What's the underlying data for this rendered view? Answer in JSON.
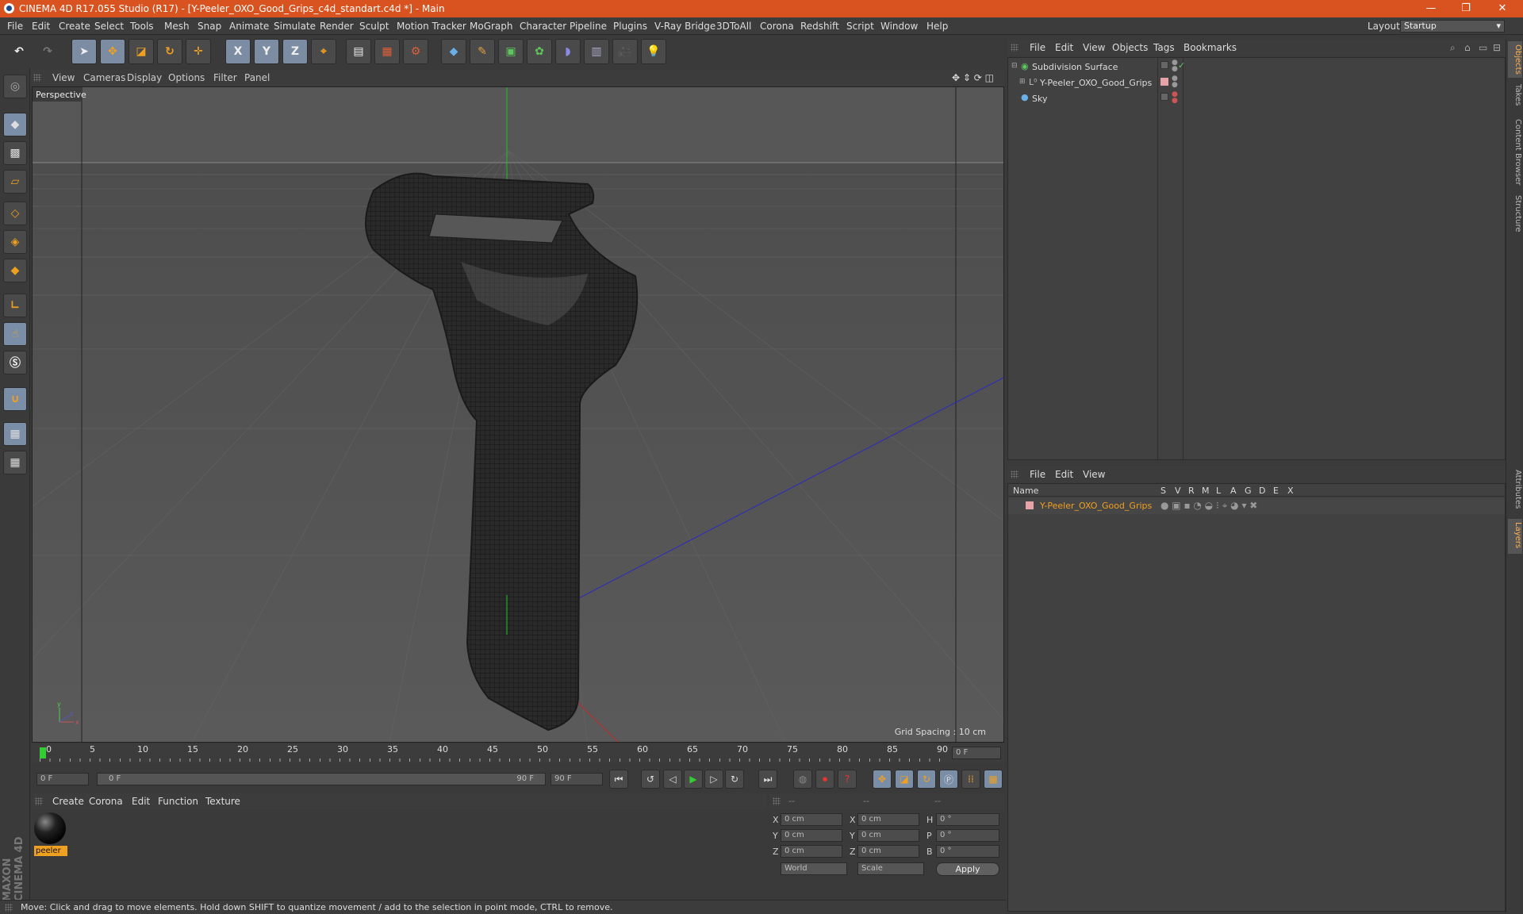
{
  "window": {
    "title": "CINEMA 4D R17.055 Studio (R17) - [Y-Peeler_OXO_Good_Grips_c4d_standart.c4d *] - Main",
    "minimize": "—",
    "maximize": "❐",
    "close": "✕"
  },
  "menu": [
    "File",
    "Edit",
    "Create",
    "Select",
    "Tools",
    "Mesh",
    "Snap",
    "Animate",
    "Simulate",
    "Render",
    "Sculpt",
    "Motion Tracker",
    "MoGraph",
    "Character",
    "Pipeline",
    "Plugins",
    "V-Ray Bridge",
    "3DToAll",
    "Corona",
    "Redshift",
    "Script",
    "Window",
    "Help"
  ],
  "layout": {
    "label": "Layout:",
    "value": "Startup"
  },
  "toolbar": {
    "axis_x": "X",
    "axis_y": "Y",
    "axis_z": "Z"
  },
  "viewport": {
    "menu": [
      "View",
      "Cameras",
      "Display",
      "Options",
      "Filter",
      "Panel"
    ],
    "label": "Perspective",
    "grid_spacing": "Grid Spacing : 10 cm"
  },
  "timeline": {
    "ticks": [
      "0",
      "5",
      "10",
      "15",
      "20",
      "25",
      "30",
      "35",
      "40",
      "45",
      "50",
      "55",
      "60",
      "65",
      "70",
      "75",
      "80",
      "85",
      "90"
    ],
    "end_field": "0 F",
    "current_field": "0 F",
    "range_start": "0 F",
    "range_end": "90 F",
    "max_field": "90 F"
  },
  "materials": {
    "menu": [
      "Create",
      "Corona",
      "Edit",
      "Function",
      "Texture"
    ],
    "items": [
      {
        "name": "peeler"
      }
    ]
  },
  "coordinates": {
    "headers": [
      "--",
      "--",
      "--"
    ],
    "rows": [
      {
        "a": "X",
        "av": "0 cm",
        "b": "X",
        "bv": "0 cm",
        "c": "H",
        "cv": "0 °"
      },
      {
        "a": "Y",
        "av": "0 cm",
        "b": "Y",
        "bv": "0 cm",
        "c": "P",
        "cv": "0 °"
      },
      {
        "a": "Z",
        "av": "0 cm",
        "b": "Z",
        "bv": "0 cm",
        "c": "B",
        "cv": "0 °"
      }
    ],
    "mode1": "World",
    "mode2": "Scale",
    "apply": "Apply"
  },
  "status": "Move: Click and drag to move elements. Hold down SHIFT to quantize movement / add to the selection in point mode, CTRL to remove.",
  "objects": {
    "menu": [
      "File",
      "Edit",
      "View",
      "Objects",
      "Tags",
      "Bookmarks"
    ],
    "rows": [
      {
        "name": "Subdivision Surface"
      },
      {
        "name": "Y-Peeler_OXO_Good_Grips"
      },
      {
        "name": "Sky"
      }
    ]
  },
  "layers": {
    "menu": [
      "File",
      "Edit",
      "View"
    ],
    "columns": [
      "Name",
      "S",
      "V",
      "R",
      "M",
      "L",
      "A",
      "G",
      "D",
      "E",
      "X"
    ],
    "rows": [
      {
        "name": "Y-Peeler_OXO_Good_Grips"
      }
    ]
  },
  "side_tabs": [
    "Objects",
    "Takes",
    "Content Browser",
    "Structure",
    "Attributes",
    "Layers"
  ],
  "maxon_brand": "MAXON CINEMA 4D",
  "colors": {
    "accent": "#d8531f",
    "selection": "#f0a020",
    "layer_color": "#e7a4a8"
  }
}
